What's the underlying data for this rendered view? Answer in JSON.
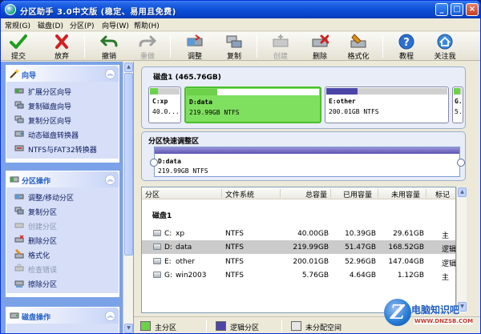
{
  "window": {
    "title": "分区助手 3.0中文版 (稳定、易用且免费)",
    "minimize": "_",
    "maximize": "□",
    "close": "×"
  },
  "menu": [
    "常规(G)",
    "磁盘(D)",
    "分区(P)",
    "向导(W)",
    "帮助(H)"
  ],
  "toolbar": {
    "submit": "提交",
    "discard": "放弃",
    "undo": "撤销",
    "redo": "重做",
    "adjust": "调整",
    "copy": "复制",
    "create": "创建",
    "delete": "删除",
    "format": "格式化",
    "tutorial": "教程",
    "follow": "关注我"
  },
  "sidebar": {
    "wizard": {
      "title": "向导",
      "items": [
        "扩展分区向导",
        "复制磁盘向导",
        "复制分区向导",
        "动态磁盘转换器",
        "NTFS与FAT32转换器"
      ]
    },
    "partition_ops": {
      "title": "分区操作",
      "items": [
        "调整/移动分区",
        "复制分区",
        "创建分区",
        "删除分区",
        "格式化",
        "检查错误",
        "擦除分区"
      ],
      "disabled": [
        false,
        false,
        true,
        false,
        false,
        true,
        false
      ]
    },
    "disk_ops": {
      "title": "磁盘操作"
    }
  },
  "diskmap": {
    "title": "磁盘1 (465.76GB)",
    "partitions": [
      {
        "name": "C:xp",
        "size": "40.0...",
        "used_fraction": 0.26,
        "color": "#6dd24a"
      },
      {
        "name": "D:data",
        "size": "219.99GB NTFS",
        "used_fraction": 0.23,
        "color": "#6dd24a"
      },
      {
        "name": "E:other",
        "size": "200.01GB NTFS",
        "used_fraction": 0.26,
        "color": "#4a46a8"
      },
      {
        "name": "G.",
        "size": "5.",
        "used_fraction": 0.8,
        "color": "#6dd24a"
      }
    ]
  },
  "quick_resize": {
    "title": "分区快速调整区",
    "name": "D:data",
    "size": "219.99GB NTFS"
  },
  "table": {
    "headers": [
      "分区",
      "文件系统",
      "总容量",
      "已用容量",
      "未用容量",
      "标记"
    ],
    "disk_label": "磁盘1",
    "rows": [
      {
        "name": "C:",
        "label": "xp",
        "fs": "NTFS",
        "total": "40.00GB",
        "used": "10.39GB",
        "free": "29.61GB",
        "flag": "主"
      },
      {
        "name": "D:",
        "label": "data",
        "fs": "NTFS",
        "total": "219.99GB",
        "used": "51.47GB",
        "free": "168.52GB",
        "flag": "逻辑"
      },
      {
        "name": "E:",
        "label": "other",
        "fs": "NTFS",
        "total": "200.01GB",
        "used": "52.96GB",
        "free": "147.04GB",
        "flag": "逻辑"
      },
      {
        "name": "G:",
        "label": "win2003",
        "fs": "NTFS",
        "total": "5.76GB",
        "used": "4.64GB",
        "free": "1.12GB",
        "flag": "主"
      }
    ]
  },
  "legend": {
    "primary": "主分区",
    "logical": "逻辑分区",
    "unallocated": "未分配空间"
  },
  "watermark": {
    "letter": "Z",
    "text": "电脑知识吧",
    "url": "WWW.DNZSB.COM"
  }
}
